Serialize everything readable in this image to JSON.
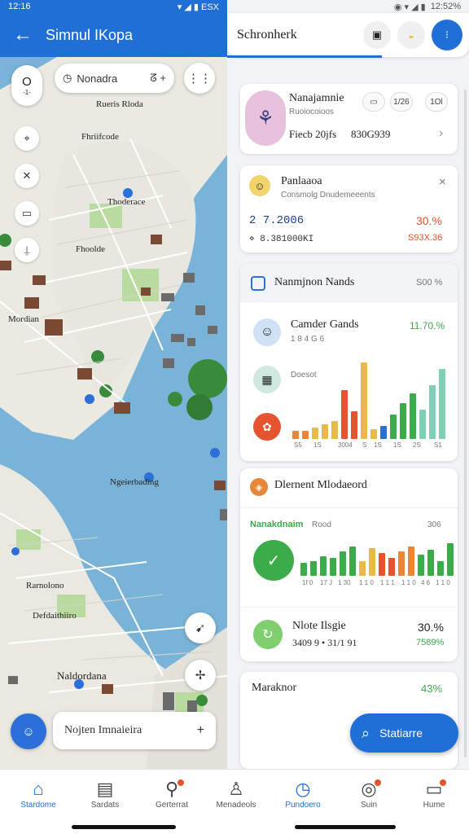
{
  "left_status": {
    "time": "12:16",
    "battery": "ESX"
  },
  "left_appbar": {
    "back_icon": "arrow-left-icon",
    "title": "Simnul IKopa"
  },
  "map": {
    "search_pill": {
      "label": "Nonadra",
      "extra": "ᘔ +"
    },
    "tool_top": "O",
    "tool_sub": "-1-",
    "labels": [
      "Rueris Rloda",
      "Fhriifcode",
      "Thoderace",
      "Fhoolde",
      "Mordian",
      "Ngeierbading",
      "Rarnolono",
      "Defdaithiiro",
      "Naldordana"
    ],
    "bottom_card": {
      "label": "Nojten Imnaieira",
      "action": "+"
    }
  },
  "right_status": {
    "time": "12:52%"
  },
  "right_appbar": {
    "title": "Schronherk"
  },
  "card1": {
    "title": "Nanajamnie",
    "subtitle": "Ruoiocoioos",
    "meta": "Fiecb 20jfs",
    "value": "830G939",
    "chip1": "▭",
    "chip2": "1/26",
    "chip3": "1Ol",
    "chevron": "›"
  },
  "card2": {
    "title": "Panlaaoa",
    "subtitle": "Consmolg  Dnudemeeents",
    "value1": "2 7.2006",
    "value2": "⋄ 8.381000KI",
    "pct1": "30.%",
    "pct2": "S93X.36",
    "close": "×"
  },
  "card3": {
    "title": "Nanmjnon Nands",
    "pct": "S00 %",
    "item_title": "Camder Gands",
    "item_sub": "1 8 4 G 6",
    "item_pct": "11.70.%",
    "label2": "Doesot",
    "axis": [
      "S5",
      "1S",
      "3004",
      "S",
      "1S",
      "1S",
      "2S",
      "S1"
    ]
  },
  "card4": {
    "title": "Dlernent Mlodaeord",
    "legend": "Nanakdnaim",
    "legend_sub": "Rood",
    "legend_val": "306",
    "axis": [
      "1f 0",
      "17 J",
      "1 30",
      "1 1 0",
      "1 1 1",
      "1 1 0",
      "4 6",
      "1 1 0"
    ],
    "row_title": "Nlote Ilsgie",
    "row_sub": "3409 9 • 31/1 91",
    "row_pct": "30.%",
    "row_pct2": "7589%"
  },
  "card5": {
    "title": "Maraknor",
    "pct": "43%"
  },
  "fab": {
    "label": "Statiarre"
  },
  "bottom_nav": [
    {
      "label": "Stardome",
      "icon": "home-icon"
    },
    {
      "label": "Sardats",
      "icon": "calendar-icon"
    },
    {
      "label": "Gerterrat",
      "icon": "person-pin-icon"
    },
    {
      "label": "Menadeols",
      "icon": "person-icon"
    },
    {
      "label": "Pundoero",
      "icon": "clock-icon"
    },
    {
      "label": "Suin",
      "icon": "compass-icon"
    },
    {
      "label": "Hume",
      "icon": "chat-icon"
    }
  ],
  "colors": {
    "primary": "#1f6fd6",
    "green": "#3cab4a",
    "red": "#e5542e",
    "orange": "#e8863a",
    "teal": "#7fcfb7",
    "amber": "#e9b949",
    "blue": "#2d6fd8"
  }
}
